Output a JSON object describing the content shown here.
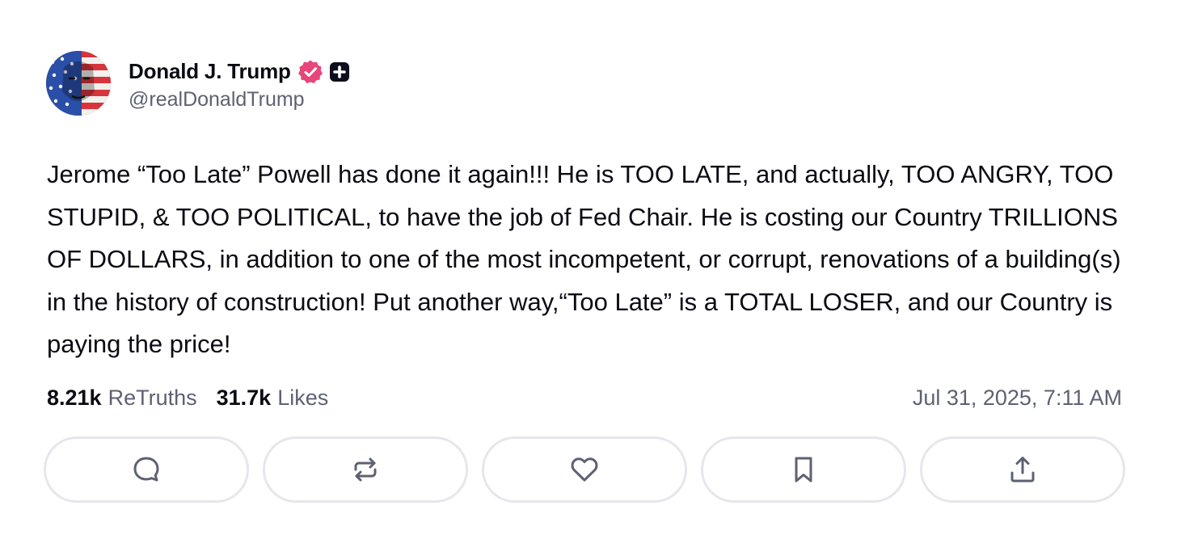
{
  "author": {
    "display_name": "Donald J. Trump",
    "handle": "@realDonaldTrump",
    "avatar_icon": "flag-face-avatar",
    "verified_icon": "verified-badge-icon",
    "badge_icon": "plus-badge-icon"
  },
  "post": {
    "text": "Jerome “Too Late” Powell has done it again!!! He is TOO LATE, and actually, TOO ANGRY, TOO STUPID, & TOO POLITICAL, to have the job of Fed Chair. He is costing our Country TRILLIONS OF DOLLARS, in addition to one of the most incompetent, or corrupt, renovations of a building(s) in the history of construction! Put another way,“Too Late” is a TOTAL LOSER, and our Country is paying the price!",
    "timestamp": "Jul 31, 2025, 7:11 AM"
  },
  "stats": {
    "retruths_count": "8.21k",
    "retruths_label": "ReTruths",
    "likes_count": "31.7k",
    "likes_label": "Likes"
  },
  "actions": [
    {
      "name": "reply",
      "icon": "comment-bubble-icon"
    },
    {
      "name": "retruth",
      "icon": "repost-arrows-icon"
    },
    {
      "name": "like",
      "icon": "heart-icon"
    },
    {
      "name": "bookmark",
      "icon": "bookmark-icon"
    },
    {
      "name": "share",
      "icon": "upload-share-icon"
    }
  ],
  "colors": {
    "text_primary": "#0b0b14",
    "text_secondary": "#5d6172",
    "verified_pink": "#e8457a",
    "button_border": "#e6e6ec",
    "icon_gray": "#5d6172"
  }
}
